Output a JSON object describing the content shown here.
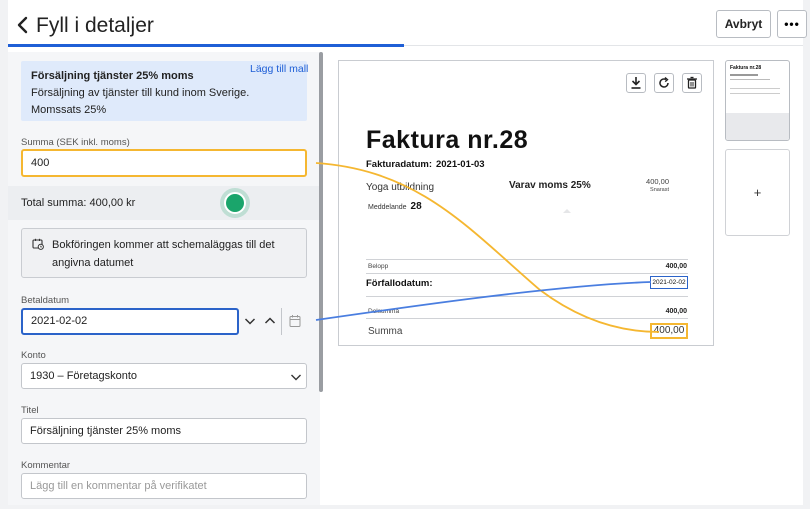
{
  "header": {
    "title": "Fyll i detaljer",
    "cancel_label": "Avbryt",
    "more_label": "•••"
  },
  "form": {
    "info": {
      "title": "Försäljning tjänster 25% moms",
      "text": "Försäljning av tjänster till kund inom Sverige. Momssats 25%"
    },
    "amount": {
      "label": "Summa (SEK inkl. moms)",
      "value": "400"
    },
    "total": {
      "text": "Total summa: 400,00 kr",
      "save_template": "Lägg till mall"
    },
    "notice": "Bokföringen kommer att schemaläggas till det angivna datumet",
    "payment_date": {
      "label": "Betaldatum",
      "value": "2021-02-02"
    },
    "account": {
      "label": "Konto",
      "value": "1930 – Företagskonto"
    },
    "title": {
      "label": "Titel",
      "value": "Försäljning tjänster 25% moms"
    },
    "comment": {
      "label": "Kommentar",
      "placeholder": "Lägg till en kommentar på verifikatet"
    }
  },
  "preview": {
    "invoice_title": "Faktura nr.28",
    "invoice_date_label": "Fakturadatum:",
    "invoice_date": "2021-01-03",
    "service": "Yoga utbildning",
    "vat_label": "Varav moms 25%",
    "amount_small": "400,00",
    "amount_small_sub": "Snarast",
    "message_label": "Meddelande",
    "message_value": "28",
    "belopp_label": "Belopp",
    "belopp_value": "400,00",
    "due_label": "Förfallodatum:",
    "due_value": "2021-02-02",
    "subtotal_label": "Delsumma",
    "subtotal_value": "400,00",
    "sum_label": "Summa",
    "sum_value": "400,00",
    "thumb_title": "Faktura nr.28",
    "add_page": "+"
  },
  "colors": {
    "accent_blue": "#1f5fd6",
    "highlight_yellow": "#f5b731",
    "hotspot_green": "#1aa56b",
    "info_bg": "#dfeafb"
  }
}
